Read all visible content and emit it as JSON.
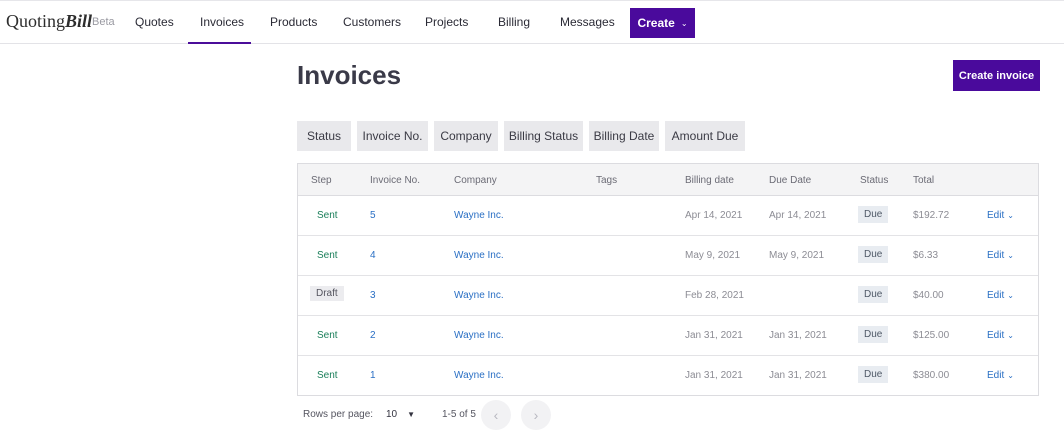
{
  "brand": {
    "name_regular": "Quoting",
    "name_bold": "Bill",
    "tag": "Beta"
  },
  "nav": {
    "items": [
      {
        "label": "Quotes"
      },
      {
        "label": "Invoices",
        "active": true
      },
      {
        "label": "Products"
      },
      {
        "label": "Customers"
      },
      {
        "label": "Projects"
      },
      {
        "label": "Billing"
      },
      {
        "label": "Messages"
      }
    ],
    "create_label": "Create"
  },
  "page": {
    "title": "Invoices",
    "create_button": "Create invoice"
  },
  "filters": [
    "Status",
    "Invoice No.",
    "Company",
    "Billing Status",
    "Billing Date",
    "Amount Due"
  ],
  "table": {
    "columns": [
      "Step",
      "Invoice No.",
      "Company",
      "Tags",
      "Billing date",
      "Due Date",
      "Status",
      "Total"
    ],
    "rows": [
      {
        "step": "Sent",
        "invoice_no": "5",
        "company": "Wayne Inc.",
        "tags": "",
        "billing_date": "Apr 14, 2021",
        "due_date": "Apr 14, 2021",
        "status": "Due",
        "total": "$192.72",
        "action": "Edit"
      },
      {
        "step": "Sent",
        "invoice_no": "4",
        "company": "Wayne Inc.",
        "tags": "",
        "billing_date": "May 9, 2021",
        "due_date": "May 9, 2021",
        "status": "Due",
        "total": "$6.33",
        "action": "Edit"
      },
      {
        "step": "Draft",
        "invoice_no": "3",
        "company": "Wayne Inc.",
        "tags": "",
        "billing_date": "Feb 28, 2021",
        "due_date": "",
        "status": "Due",
        "total": "$40.00",
        "action": "Edit"
      },
      {
        "step": "Sent",
        "invoice_no": "2",
        "company": "Wayne Inc.",
        "tags": "",
        "billing_date": "Jan 31, 2021",
        "due_date": "Jan 31, 2021",
        "status": "Due",
        "total": "$125.00",
        "action": "Edit"
      },
      {
        "step": "Sent",
        "invoice_no": "1",
        "company": "Wayne Inc.",
        "tags": "",
        "billing_date": "Jan 31, 2021",
        "due_date": "Jan 31, 2021",
        "status": "Due",
        "total": "$380.00",
        "action": "Edit"
      }
    ]
  },
  "pagination": {
    "rows_per_page_label": "Rows per page:",
    "rows_per_page": "10",
    "range": "1-5 of 5"
  },
  "icons": {
    "dropdown": "chevron-down-icon",
    "prev": "chevron-left-icon",
    "next": "chevron-right-icon"
  },
  "colors": {
    "accent": "#4a0a9c",
    "link": "#2a6fc4",
    "sent": "#1a7f5a"
  }
}
